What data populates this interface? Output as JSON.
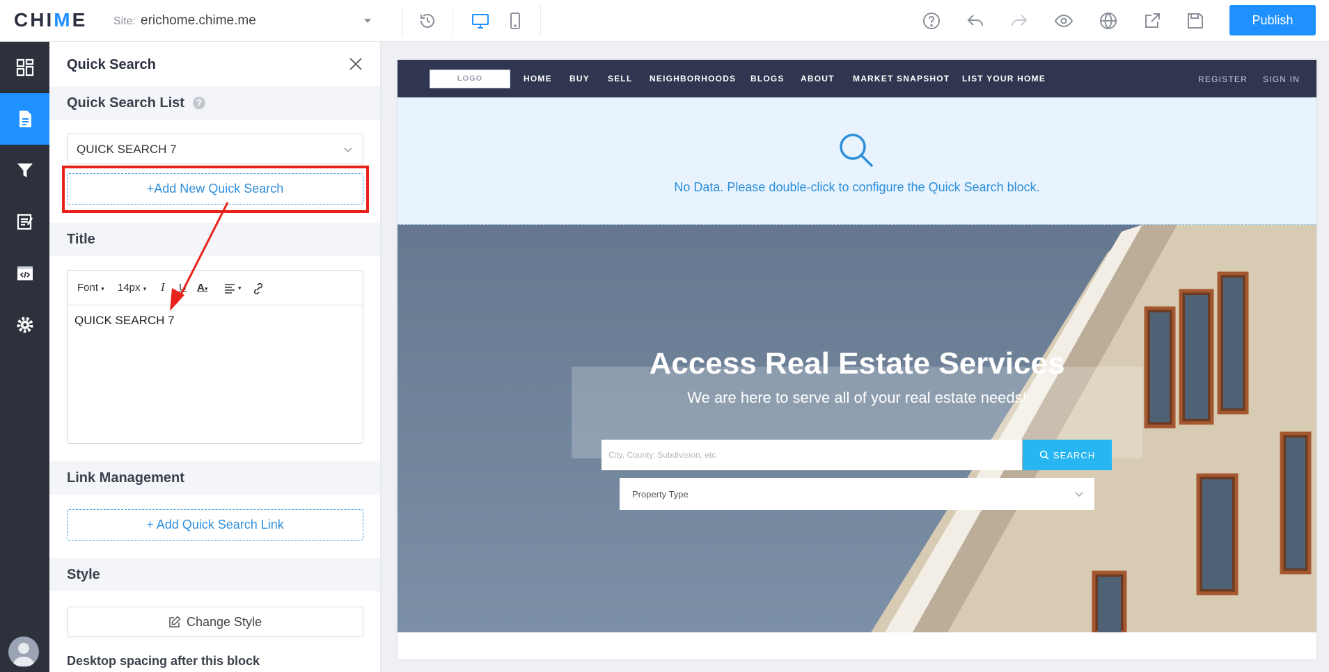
{
  "app": {
    "logo_text": "CHIME",
    "site_label": "Site:",
    "site_value": "erichome.chime.me",
    "publish_label": "Publish",
    "colors": {
      "accent": "#1e90ff",
      "rail": "#2c313c",
      "highlight": "#e8221c"
    },
    "toolbar_icons": [
      "history-icon",
      "desktop-icon",
      "mobile-icon",
      "help-icon",
      "undo-icon",
      "redo-icon",
      "preview-icon",
      "globe-icon",
      "share-icon",
      "save-icon"
    ]
  },
  "rail": {
    "items": [
      "dashboard-icon",
      "page-icon",
      "filter-icon",
      "edit-icon",
      "code-icon",
      "settings-icon"
    ],
    "active": "page-icon"
  },
  "panel": {
    "title": "Quick Search",
    "list_section": "Quick Search List",
    "help_glyph": "?",
    "selected_list": "QUICK SEARCH 7",
    "add_new_label": "+Add New Quick Search",
    "title_section": "Title",
    "editor": {
      "font_label": "Font",
      "size_label": "14px",
      "italic": "I",
      "underline": "U",
      "color": "A",
      "content": "QUICK SEARCH 7"
    },
    "link_section": "Link Management",
    "add_link_label": "+ Add Quick Search Link",
    "style_section": "Style",
    "change_style_label": "Change Style",
    "spacing_label": "Desktop spacing after this block"
  },
  "preview": {
    "logo": "LOGO",
    "nav": [
      "HOME",
      "BUY",
      "SELL",
      "NEIGHBORHOODS",
      "BLOGS",
      "ABOUT",
      "MARKET SNAPSHOT",
      "LIST YOUR HOME"
    ],
    "register": "REGISTER",
    "signin": "SIGN IN",
    "nodata_text": "No Data. Please double-click to configure the Quick Search block.",
    "hero_title": "Access Real Estate Services",
    "hero_sub": "We are here to serve all of your real estate needs!",
    "search_placeholder": "City, County, Subdivision, etc",
    "search_label": "SEARCH",
    "property_type": "Property Type"
  }
}
